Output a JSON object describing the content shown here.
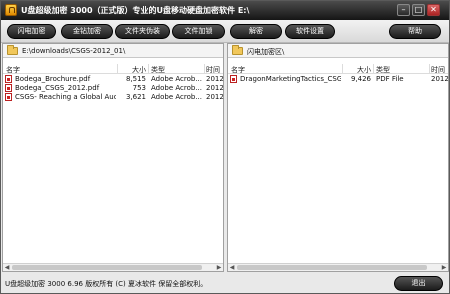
{
  "title": "U盘超级加密 3000（正式版）专业的U盘移动硬盘加密软件 E:\\",
  "window_controls": {
    "minimize": "–",
    "maximize": "□",
    "close": "✕"
  },
  "toolbar": {
    "buttons": [
      "闪电加密",
      "金钻加密",
      "文件夹伪装",
      "文件加锁",
      "解密",
      "软件设置",
      "帮助"
    ]
  },
  "left_pane": {
    "path": "E:\\downloads\\CSGS-2012_01\\",
    "columns": [
      "名字",
      "大小",
      "类型",
      "时间"
    ],
    "rows": [
      {
        "name": "Bodega_Brochure.pdf",
        "size": "8,515",
        "type": "Adobe Acrob...",
        "time": "2012/"
      },
      {
        "name": "Bodega_CSGS_2012.pdf",
        "size": "753",
        "type": "Adobe Acrob...",
        "time": "2012/"
      },
      {
        "name": "CSGS- Reaching a Global Audi...",
        "size": "3,621",
        "type": "Adobe Acrob...",
        "time": "2012/"
      }
    ]
  },
  "right_pane": {
    "path": "闪电加密区\\",
    "columns": [
      "名字",
      "大小",
      "类型",
      "时间"
    ],
    "rows": [
      {
        "name": "DragonMarketingTactics_CSG...",
        "size": "9,426",
        "type": "PDF File",
        "time": "2012/"
      }
    ]
  },
  "scroll_arrows": {
    "left": "◀",
    "right": "▶"
  },
  "status": {
    "text": "U盘超级加密 3000  6.96 版权所有 (C) 夏冰软件 保留全部权利。",
    "exit_label": "退出"
  }
}
